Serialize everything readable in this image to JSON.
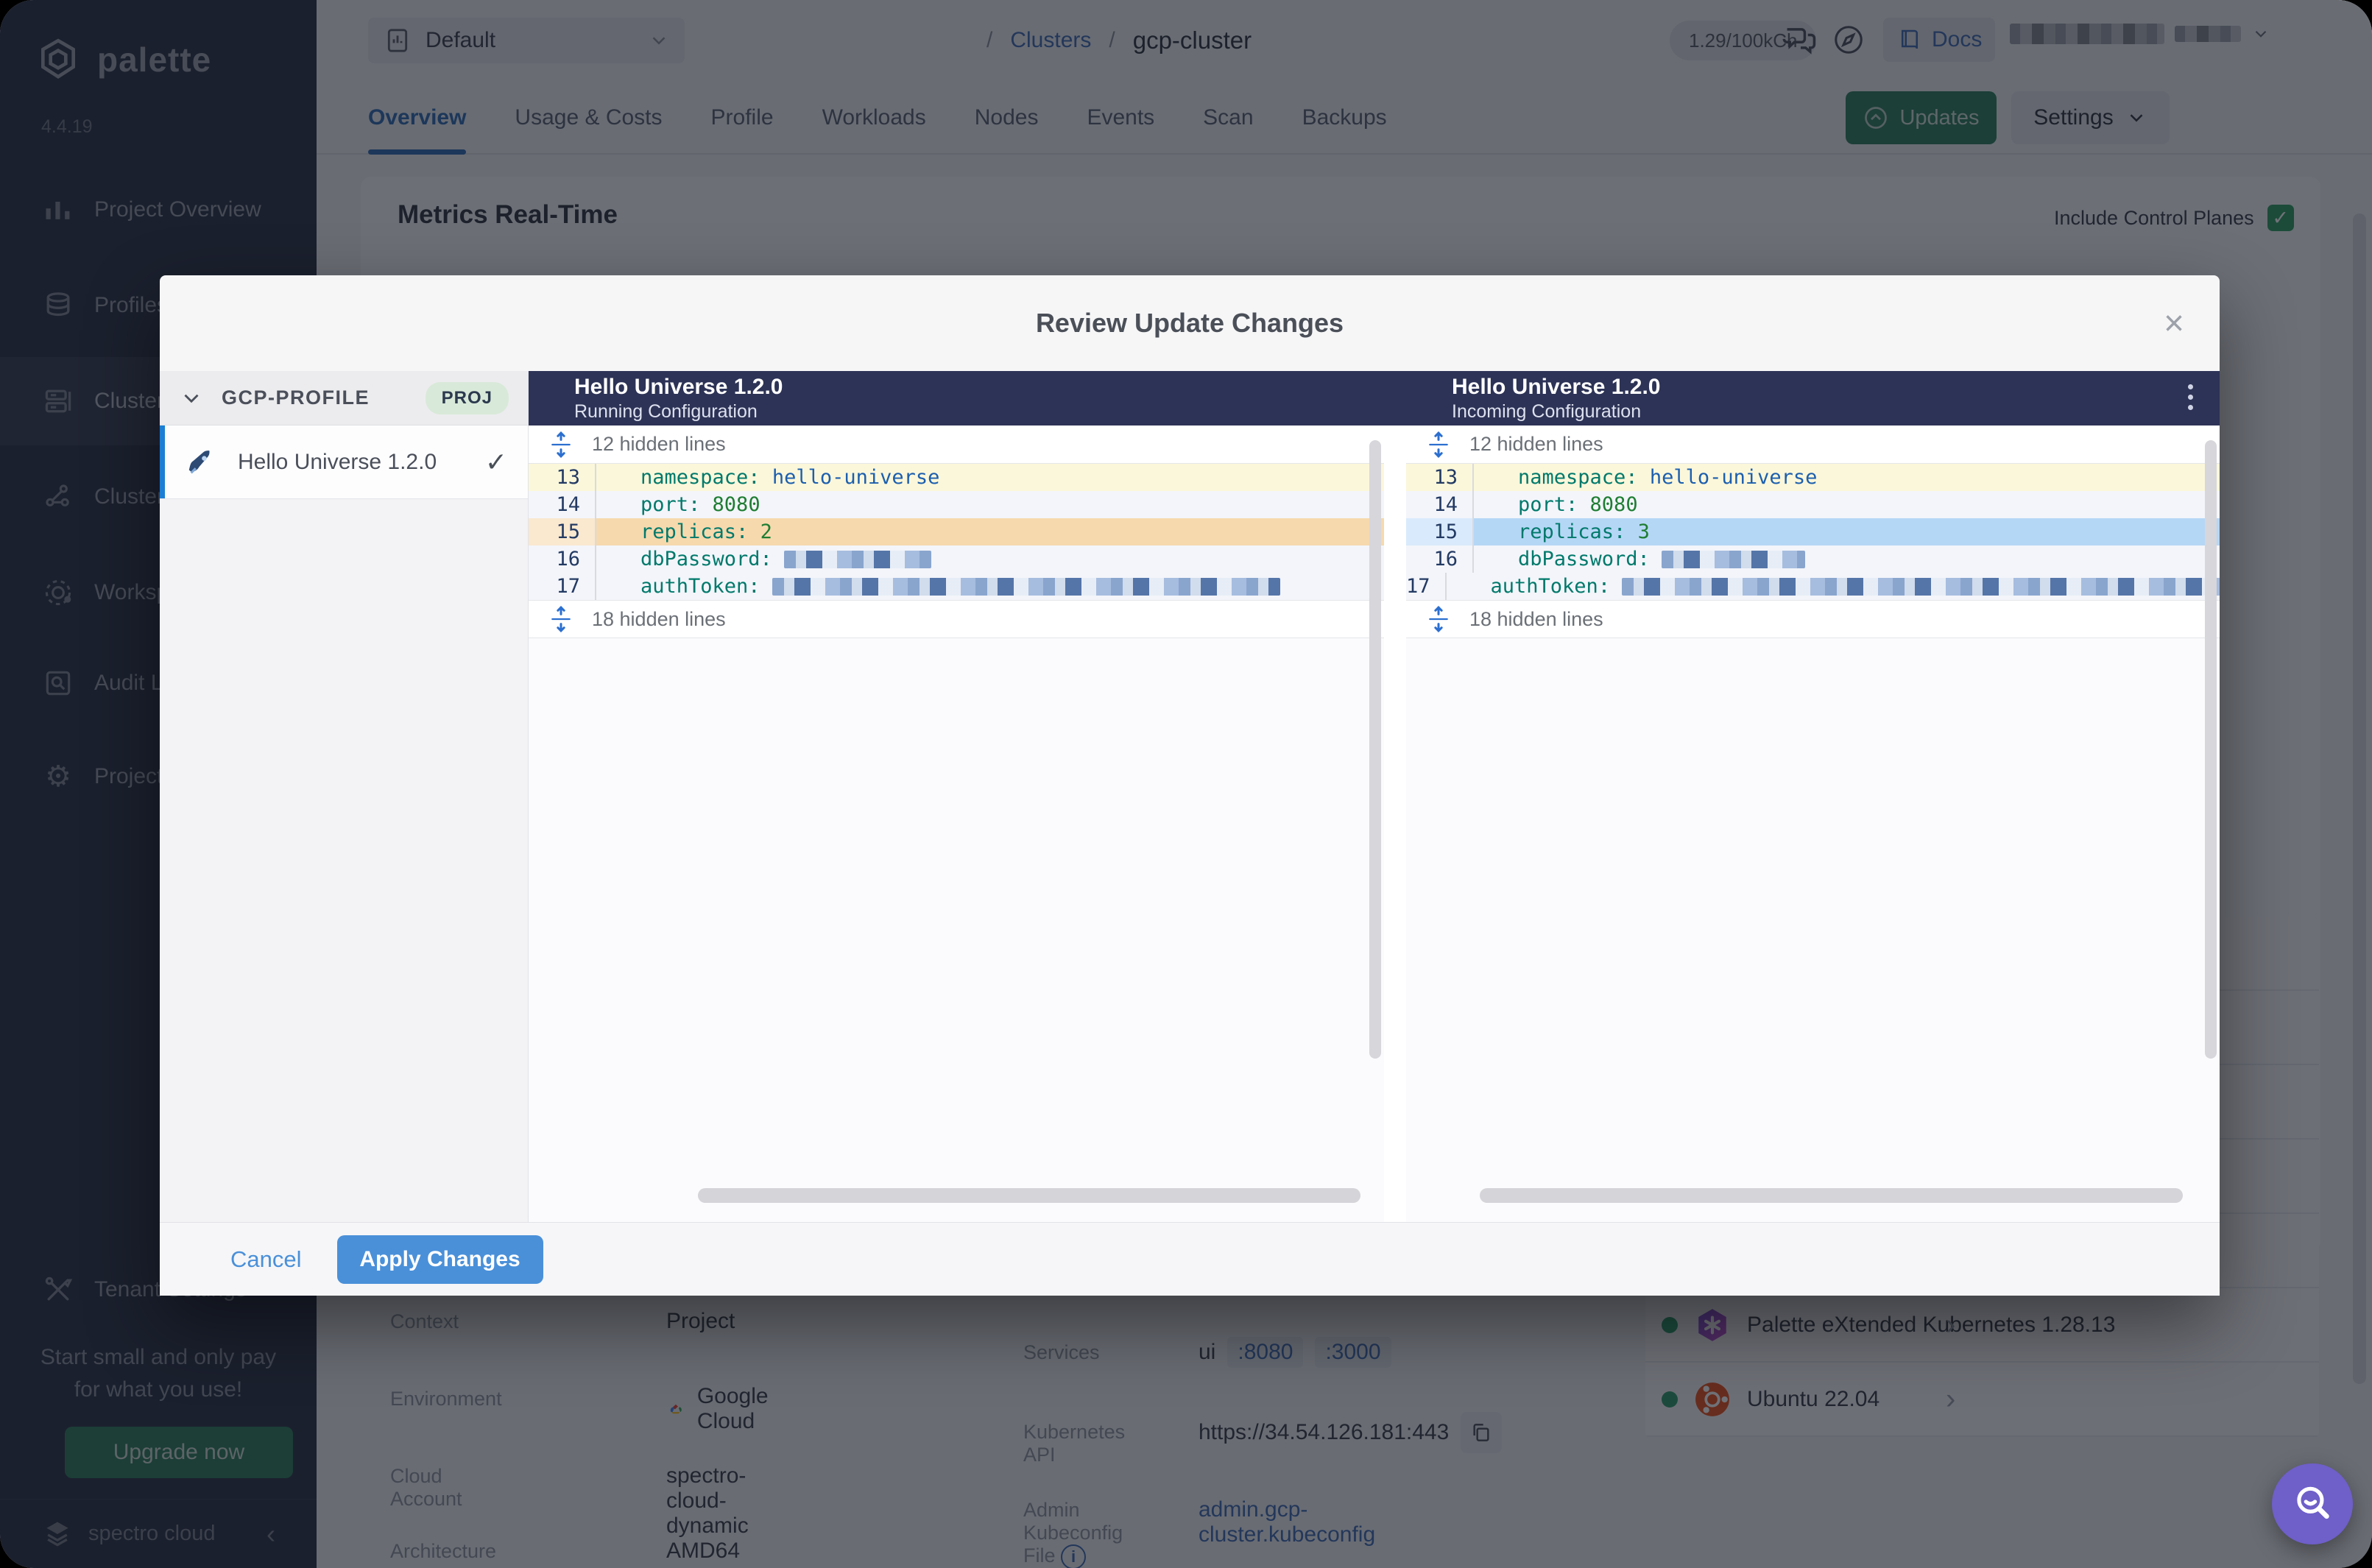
{
  "colors": {
    "accent_blue": "#4a90d9",
    "navy_header": "#2d3356",
    "green": "#2f7f60",
    "removed_bg": "#f6d9ad",
    "added_bg": "#b5d7f6",
    "active_tab": "#2d6bb4",
    "float_button": "#6e5fc9"
  },
  "app": {
    "logo_text": "palette",
    "version": "4.4.19",
    "brand": "spectro cloud",
    "collapse_icon": "‹"
  },
  "sidebar": {
    "items": [
      {
        "label": "Project Overview"
      },
      {
        "label": "Profiles"
      },
      {
        "label": "Clusters"
      },
      {
        "label": "Cluster Groups"
      },
      {
        "label": "Workspaces"
      },
      {
        "label": "Audit Logs"
      },
      {
        "label": "Project Settings"
      },
      {
        "label": "Tenant Settings"
      }
    ],
    "upsell_line1": "Start small and only pay",
    "upsell_line2": "for what you use!",
    "upgrade_label": "Upgrade now"
  },
  "topbar": {
    "project_selector": "Default",
    "breadcrumb": {
      "sep1": "/",
      "link": "Clusters",
      "sep2": "/",
      "current": "gcp-cluster"
    },
    "usage_pill": "1.29/100kCh",
    "docs_label": "Docs"
  },
  "tabs": {
    "items": [
      "Overview",
      "Usage & Costs",
      "Profile",
      "Workloads",
      "Nodes",
      "Events",
      "Scan",
      "Backups"
    ],
    "updates_label": "Updates",
    "settings_label": "Settings"
  },
  "content": {
    "metrics_title": "Metrics Real-Time",
    "include_control_planes_label": "Include Control Planes",
    "checkbox_check": "✓",
    "details": [
      {
        "label": "Context",
        "value": "Project"
      },
      {
        "label": "Environment",
        "value": "Google Cloud"
      },
      {
        "label": "Cloud Account",
        "value": "spectro-cloud-dynamic"
      },
      {
        "label": "Architecture",
        "value": "AMD64"
      }
    ],
    "services": {
      "label": "Services",
      "name": "ui",
      "port1": ":8080",
      "port2": ":3000",
      "k8s_label": "Kubernetes API",
      "k8s_value": "https://34.54.126.181:443",
      "kubeconfig_label": "Admin Kubeconfig File",
      "info_glyph": "i",
      "kubeconfig_value": "admin.gcp-cluster.kubeconfig"
    },
    "packs": {
      "rows": [
        "",
        "",
        "",
        "",
        "",
        "Palette eXtended Kubernetes 1.28.13",
        "Ubuntu 22.04"
      ],
      "chevron": "›"
    }
  },
  "modal": {
    "title": "Review Update Changes",
    "close_glyph": "×",
    "profile_group": {
      "name": "GCP-PROFILE",
      "badge": "PROJ"
    },
    "profile_item": {
      "name": "Hello Universe 1.2.0",
      "check": "✓"
    },
    "diff": {
      "left_title": "Hello Universe 1.2.0",
      "left_subtitle": "Running Configuration",
      "right_title": "Hello Universe 1.2.0",
      "right_subtitle": "Incoming Configuration",
      "hidden_top": "12 hidden lines",
      "hidden_bottom": "18 hidden lines",
      "rows": [
        {
          "num": "13",
          "key": "namespace:",
          "value_left": "hello-universe",
          "value_right": "hello-universe"
        },
        {
          "num": "14",
          "key": "port:",
          "value_left": "8080",
          "value_right": "8080"
        },
        {
          "num": "15",
          "key": "replicas:",
          "value_left": "2",
          "value_right": "3"
        },
        {
          "num": "16",
          "key": "dbPassword:",
          "redact_left_style": "width:200px",
          "redact_right_style": "width:195px"
        },
        {
          "num": "17",
          "key": "authToken:",
          "redact_left_style": "width:690px",
          "redact_right_style": "width:850px"
        }
      ]
    },
    "footer": {
      "cancel": "Cancel",
      "apply": "Apply Changes"
    }
  }
}
